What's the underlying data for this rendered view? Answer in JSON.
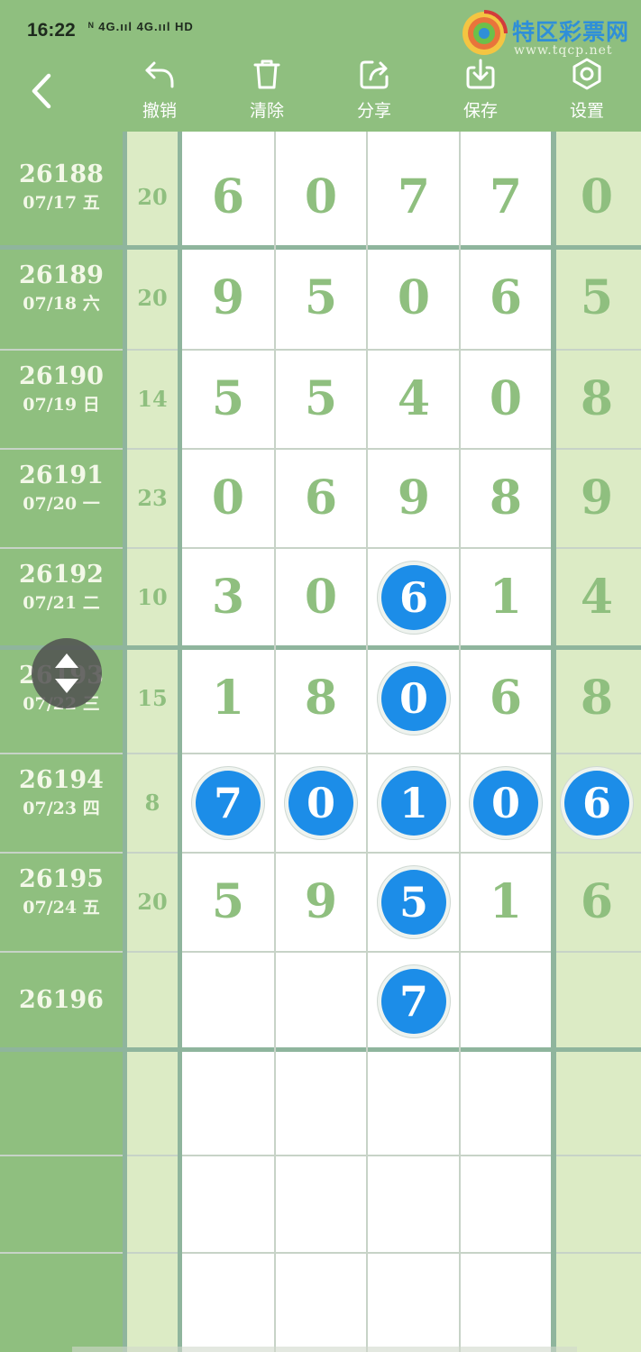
{
  "status": {
    "time": "16:22",
    "signal_text": "ᴺ 4G.ııl 4G.ııl HD"
  },
  "logo": {
    "name": "特区彩票网",
    "url": "www.tqcp.net"
  },
  "toolbar": {
    "undo_label": "撤销",
    "clear_label": "清除",
    "share_label": "分享",
    "save_label": "保存",
    "settings_label": "设置"
  },
  "colors": {
    "header_bg": "#8fbf7f",
    "sum_bg": "#dcebc5",
    "digit_color": "#8fbf7f",
    "ball_color": "#1c8de8"
  },
  "rows": [
    {
      "period": "26188",
      "date": "07/17 五",
      "sum": "20",
      "digits": [
        "6",
        "0",
        "7",
        "7",
        "0"
      ]
    },
    {
      "period": "26189",
      "date": "07/18 六",
      "sum": "20",
      "digits": [
        "9",
        "5",
        "0",
        "6",
        "5"
      ]
    },
    {
      "period": "26190",
      "date": "07/19 日",
      "sum": "14",
      "digits": [
        "5",
        "5",
        "4",
        "0",
        "8"
      ]
    },
    {
      "period": "26191",
      "date": "07/20 一",
      "sum": "23",
      "digits": [
        "0",
        "6",
        "9",
        "8",
        "9"
      ]
    },
    {
      "period": "26192",
      "date": "07/21 二",
      "sum": "10",
      "digits": [
        "3",
        "0",
        "6",
        "1",
        "4"
      ]
    },
    {
      "period": "26193",
      "date": "07/22 三",
      "sum": "15",
      "digits": [
        "1",
        "8",
        "0",
        "6",
        "8"
      ]
    },
    {
      "period": "26194",
      "date": "07/23 四",
      "sum": "8",
      "digits": [
        "7",
        "0",
        "1",
        "0",
        "6"
      ]
    },
    {
      "period": "26195",
      "date": "07/24 五",
      "sum": "20",
      "digits": [
        "5",
        "9",
        "5",
        "1",
        "6"
      ]
    },
    {
      "period": "26196",
      "date": "",
      "sum": "",
      "digits": [
        "",
        "",
        "7",
        "",
        ""
      ]
    }
  ]
}
